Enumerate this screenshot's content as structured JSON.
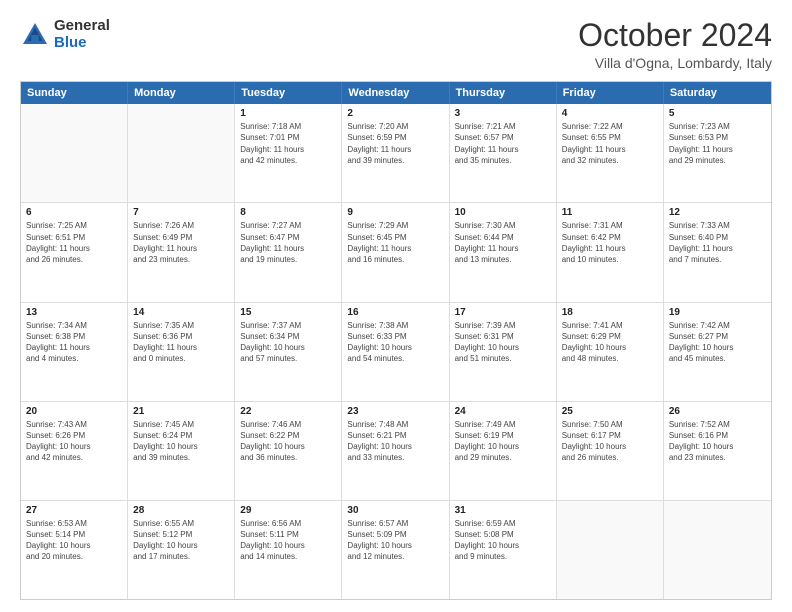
{
  "header": {
    "logo_general": "General",
    "logo_blue": "Blue",
    "month": "October 2024",
    "location": "Villa d'Ogna, Lombardy, Italy"
  },
  "days_of_week": [
    "Sunday",
    "Monday",
    "Tuesday",
    "Wednesday",
    "Thursday",
    "Friday",
    "Saturday"
  ],
  "weeks": [
    [
      {
        "day": "",
        "lines": [],
        "empty": true
      },
      {
        "day": "",
        "lines": [],
        "empty": true
      },
      {
        "day": "1",
        "lines": [
          "Sunrise: 7:18 AM",
          "Sunset: 7:01 PM",
          "Daylight: 11 hours",
          "and 42 minutes."
        ]
      },
      {
        "day": "2",
        "lines": [
          "Sunrise: 7:20 AM",
          "Sunset: 6:59 PM",
          "Daylight: 11 hours",
          "and 39 minutes."
        ]
      },
      {
        "day": "3",
        "lines": [
          "Sunrise: 7:21 AM",
          "Sunset: 6:57 PM",
          "Daylight: 11 hours",
          "and 35 minutes."
        ]
      },
      {
        "day": "4",
        "lines": [
          "Sunrise: 7:22 AM",
          "Sunset: 6:55 PM",
          "Daylight: 11 hours",
          "and 32 minutes."
        ]
      },
      {
        "day": "5",
        "lines": [
          "Sunrise: 7:23 AM",
          "Sunset: 6:53 PM",
          "Daylight: 11 hours",
          "and 29 minutes."
        ]
      }
    ],
    [
      {
        "day": "6",
        "lines": [
          "Sunrise: 7:25 AM",
          "Sunset: 6:51 PM",
          "Daylight: 11 hours",
          "and 26 minutes."
        ]
      },
      {
        "day": "7",
        "lines": [
          "Sunrise: 7:26 AM",
          "Sunset: 6:49 PM",
          "Daylight: 11 hours",
          "and 23 minutes."
        ]
      },
      {
        "day": "8",
        "lines": [
          "Sunrise: 7:27 AM",
          "Sunset: 6:47 PM",
          "Daylight: 11 hours",
          "and 19 minutes."
        ]
      },
      {
        "day": "9",
        "lines": [
          "Sunrise: 7:29 AM",
          "Sunset: 6:45 PM",
          "Daylight: 11 hours",
          "and 16 minutes."
        ]
      },
      {
        "day": "10",
        "lines": [
          "Sunrise: 7:30 AM",
          "Sunset: 6:44 PM",
          "Daylight: 11 hours",
          "and 13 minutes."
        ]
      },
      {
        "day": "11",
        "lines": [
          "Sunrise: 7:31 AM",
          "Sunset: 6:42 PM",
          "Daylight: 11 hours",
          "and 10 minutes."
        ]
      },
      {
        "day": "12",
        "lines": [
          "Sunrise: 7:33 AM",
          "Sunset: 6:40 PM",
          "Daylight: 11 hours",
          "and 7 minutes."
        ]
      }
    ],
    [
      {
        "day": "13",
        "lines": [
          "Sunrise: 7:34 AM",
          "Sunset: 6:38 PM",
          "Daylight: 11 hours",
          "and 4 minutes."
        ]
      },
      {
        "day": "14",
        "lines": [
          "Sunrise: 7:35 AM",
          "Sunset: 6:36 PM",
          "Daylight: 11 hours",
          "and 0 minutes."
        ]
      },
      {
        "day": "15",
        "lines": [
          "Sunrise: 7:37 AM",
          "Sunset: 6:34 PM",
          "Daylight: 10 hours",
          "and 57 minutes."
        ]
      },
      {
        "day": "16",
        "lines": [
          "Sunrise: 7:38 AM",
          "Sunset: 6:33 PM",
          "Daylight: 10 hours",
          "and 54 minutes."
        ]
      },
      {
        "day": "17",
        "lines": [
          "Sunrise: 7:39 AM",
          "Sunset: 6:31 PM",
          "Daylight: 10 hours",
          "and 51 minutes."
        ]
      },
      {
        "day": "18",
        "lines": [
          "Sunrise: 7:41 AM",
          "Sunset: 6:29 PM",
          "Daylight: 10 hours",
          "and 48 minutes."
        ]
      },
      {
        "day": "19",
        "lines": [
          "Sunrise: 7:42 AM",
          "Sunset: 6:27 PM",
          "Daylight: 10 hours",
          "and 45 minutes."
        ]
      }
    ],
    [
      {
        "day": "20",
        "lines": [
          "Sunrise: 7:43 AM",
          "Sunset: 6:26 PM",
          "Daylight: 10 hours",
          "and 42 minutes."
        ]
      },
      {
        "day": "21",
        "lines": [
          "Sunrise: 7:45 AM",
          "Sunset: 6:24 PM",
          "Daylight: 10 hours",
          "and 39 minutes."
        ]
      },
      {
        "day": "22",
        "lines": [
          "Sunrise: 7:46 AM",
          "Sunset: 6:22 PM",
          "Daylight: 10 hours",
          "and 36 minutes."
        ]
      },
      {
        "day": "23",
        "lines": [
          "Sunrise: 7:48 AM",
          "Sunset: 6:21 PM",
          "Daylight: 10 hours",
          "and 33 minutes."
        ]
      },
      {
        "day": "24",
        "lines": [
          "Sunrise: 7:49 AM",
          "Sunset: 6:19 PM",
          "Daylight: 10 hours",
          "and 29 minutes."
        ]
      },
      {
        "day": "25",
        "lines": [
          "Sunrise: 7:50 AM",
          "Sunset: 6:17 PM",
          "Daylight: 10 hours",
          "and 26 minutes."
        ]
      },
      {
        "day": "26",
        "lines": [
          "Sunrise: 7:52 AM",
          "Sunset: 6:16 PM",
          "Daylight: 10 hours",
          "and 23 minutes."
        ]
      }
    ],
    [
      {
        "day": "27",
        "lines": [
          "Sunrise: 6:53 AM",
          "Sunset: 5:14 PM",
          "Daylight: 10 hours",
          "and 20 minutes."
        ]
      },
      {
        "day": "28",
        "lines": [
          "Sunrise: 6:55 AM",
          "Sunset: 5:12 PM",
          "Daylight: 10 hours",
          "and 17 minutes."
        ]
      },
      {
        "day": "29",
        "lines": [
          "Sunrise: 6:56 AM",
          "Sunset: 5:11 PM",
          "Daylight: 10 hours",
          "and 14 minutes."
        ]
      },
      {
        "day": "30",
        "lines": [
          "Sunrise: 6:57 AM",
          "Sunset: 5:09 PM",
          "Daylight: 10 hours",
          "and 12 minutes."
        ]
      },
      {
        "day": "31",
        "lines": [
          "Sunrise: 6:59 AM",
          "Sunset: 5:08 PM",
          "Daylight: 10 hours",
          "and 9 minutes."
        ]
      },
      {
        "day": "",
        "lines": [],
        "empty": true
      },
      {
        "day": "",
        "lines": [],
        "empty": true
      }
    ]
  ]
}
